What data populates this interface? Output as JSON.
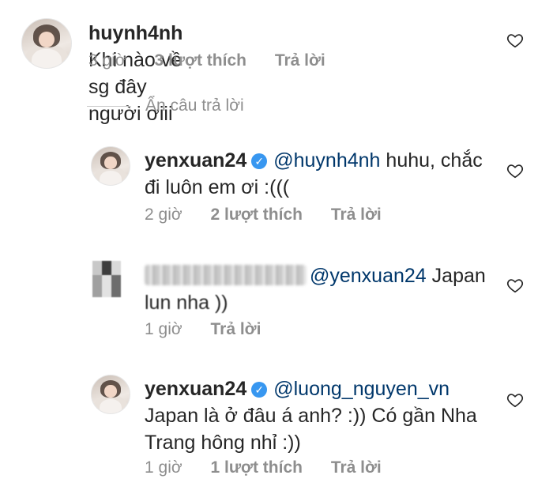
{
  "comments": [
    {
      "username": "huynh4nh",
      "text": "Khi nào về sg đây người ơiii",
      "time": "3 giờ",
      "likes": "3 lượt thích",
      "reply": "Trả lời"
    }
  ],
  "hide_replies": "Ẩn câu trả lời",
  "replies": [
    {
      "username": "yenxuan24",
      "mention": "@huynh4nh",
      "text_line1": "huhu, chắc",
      "text_line2": "đi luôn em ơi :(((",
      "time": "2 giờ",
      "likes": "2 lượt thích",
      "reply": "Trả lời"
    },
    {
      "username_blurred": true,
      "mention": "@yenxuan24",
      "text_line1": "Japan",
      "text_line2": "lun nha ))",
      "time": "1 giờ",
      "reply": "Trả lời"
    },
    {
      "username": "yenxuan24",
      "mention": "@luong_nguyen_vn",
      "text_line2": "Japan là ở đâu á anh? :)) Có gần Nha",
      "text_line3": "Trang hông nhỉ :))",
      "time": "1 giờ",
      "likes": "1 lượt thích",
      "reply": "Trả lời"
    }
  ],
  "icons": {
    "like": "heart-outline-icon",
    "verified": "verified-badge-icon"
  },
  "colors": {
    "text": "#262626",
    "meta": "#8e8e8e",
    "mention": "#00376b",
    "verified": "#3897f0"
  }
}
